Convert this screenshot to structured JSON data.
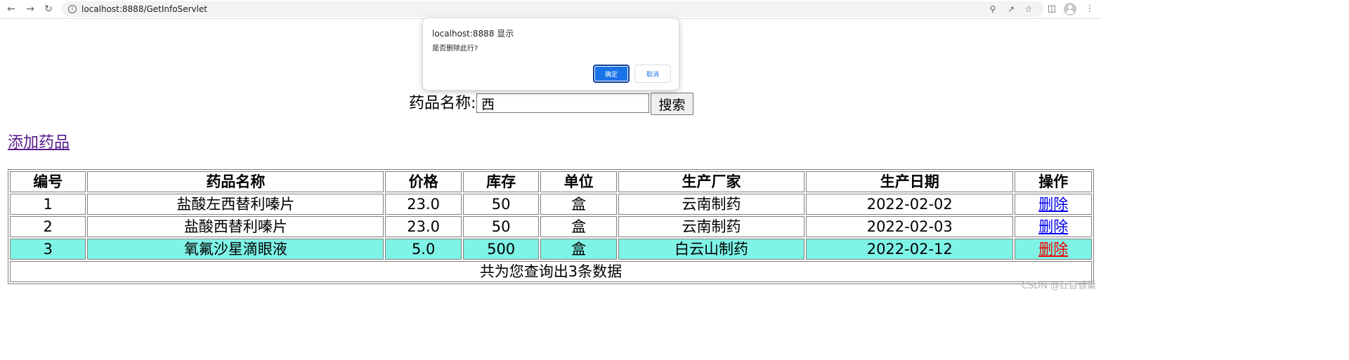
{
  "browser": {
    "url": "localhost:8888/GetInfoServlet",
    "icons": {
      "back": "arrow-left-icon",
      "forward": "arrow-right-icon",
      "reload": "reload-icon",
      "info": "info-icon",
      "zoom": "zoom-icon",
      "share": "share-icon",
      "bookmark": "star-icon",
      "sidepanel": "side-panel-icon",
      "profile": "profile-icon",
      "menu": "kebab-menu-icon"
    }
  },
  "search": {
    "label": "药品名称:",
    "value": "西",
    "button_label": "搜索"
  },
  "add_link": "添加药品",
  "table": {
    "headers": [
      "编号",
      "药品名称",
      "价格",
      "库存",
      "单位",
      "生产厂家",
      "生产日期",
      "操作"
    ],
    "rows": [
      {
        "id": "1",
        "name": "盐酸左西替利嗪片",
        "price": "23.0",
        "stock": "50",
        "unit": "盒",
        "maker": "云南制药",
        "date": "2022-02-02",
        "action": "删除"
      },
      {
        "id": "2",
        "name": "盐酸西替利嗪片",
        "price": "23.0",
        "stock": "50",
        "unit": "盒",
        "maker": "云南制药",
        "date": "2022-02-03",
        "action": "删除"
      },
      {
        "id": "3",
        "name": "氧氟沙星滴眼液",
        "price": "5.0",
        "stock": "500",
        "unit": "盒",
        "maker": "白云山制药",
        "date": "2022-02-12",
        "action": "删除"
      }
    ],
    "footer": "共为您查询出3条数据"
  },
  "dialog": {
    "title": "localhost:8888 显示",
    "message": "是否删除此行?",
    "ok_label": "确定",
    "cancel_label": "取消"
  },
  "watermark": "CSDN @红目香薰",
  "colors": {
    "highlight_row": "#7ff3e6",
    "link": "#0000ee",
    "visited_link": "#551a8b",
    "active_link": "#ee0000",
    "ok_button": "#1a73e8"
  }
}
